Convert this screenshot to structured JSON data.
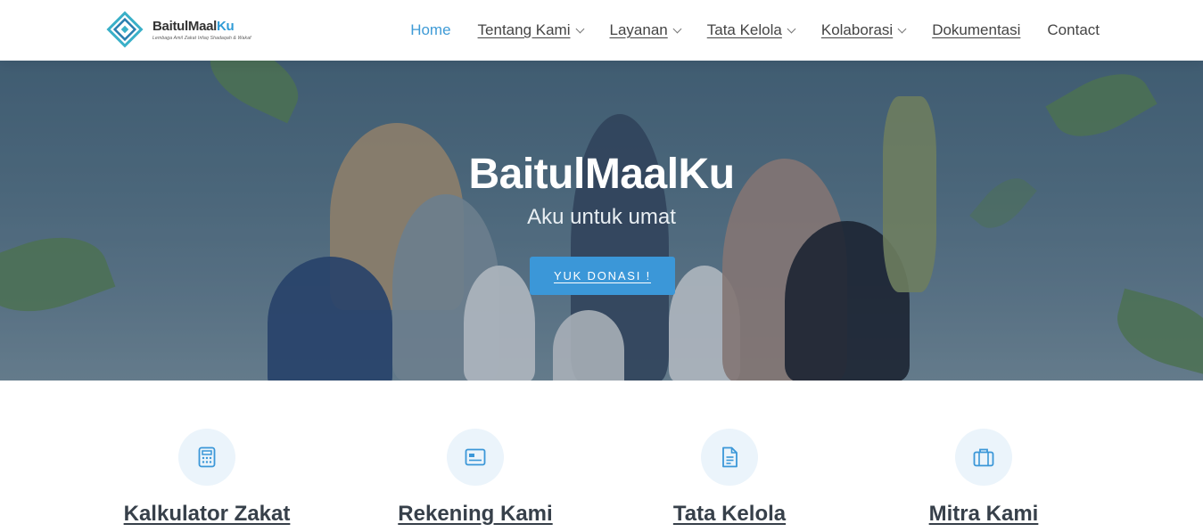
{
  "logo": {
    "name_main": "BaitulMaal",
    "name_accent": "Ku",
    "tagline": "Lembaga Amil Zakat Infaq Shadaqah & Wakaf"
  },
  "nav": {
    "items": [
      {
        "label": "Home",
        "active": true,
        "dropdown": false
      },
      {
        "label": "Tentang Kami",
        "active": false,
        "dropdown": true
      },
      {
        "label": "Layanan",
        "active": false,
        "dropdown": true
      },
      {
        "label": "Tata Kelola",
        "active": false,
        "dropdown": true
      },
      {
        "label": "Kolaborasi",
        "active": false,
        "dropdown": true
      },
      {
        "label": "Dokumentasi",
        "active": false,
        "dropdown": false
      },
      {
        "label": "Contact",
        "active": false,
        "dropdown": false
      }
    ]
  },
  "hero": {
    "title": "BaitulMaalKu",
    "subtitle": "Aku untuk umat",
    "button_label": "YUK DONASI !"
  },
  "features": [
    {
      "title": "Kalkulator Zakat",
      "icon": "calculator-icon"
    },
    {
      "title": "Rekening Kami",
      "icon": "card-icon"
    },
    {
      "title": "Tata Kelola",
      "icon": "document-icon"
    },
    {
      "title": "Mitra Kami",
      "icon": "briefcase-icon"
    }
  ],
  "colors": {
    "accent": "#3b97d8",
    "icon_bg": "#ebf4fb",
    "text_dark": "#37404a"
  }
}
